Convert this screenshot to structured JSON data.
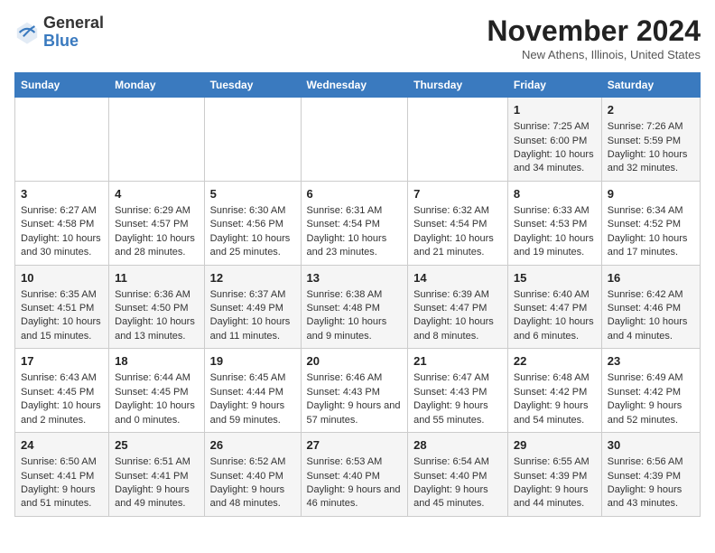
{
  "header": {
    "logo_general": "General",
    "logo_blue": "Blue",
    "month_title": "November 2024",
    "location": "New Athens, Illinois, United States"
  },
  "days_of_week": [
    "Sunday",
    "Monday",
    "Tuesday",
    "Wednesday",
    "Thursday",
    "Friday",
    "Saturday"
  ],
  "weeks": [
    [
      {
        "day": "",
        "info": ""
      },
      {
        "day": "",
        "info": ""
      },
      {
        "day": "",
        "info": ""
      },
      {
        "day": "",
        "info": ""
      },
      {
        "day": "",
        "info": ""
      },
      {
        "day": "1",
        "info": "Sunrise: 7:25 AM\nSunset: 6:00 PM\nDaylight: 10 hours and 34 minutes."
      },
      {
        "day": "2",
        "info": "Sunrise: 7:26 AM\nSunset: 5:59 PM\nDaylight: 10 hours and 32 minutes."
      }
    ],
    [
      {
        "day": "3",
        "info": "Sunrise: 6:27 AM\nSunset: 4:58 PM\nDaylight: 10 hours and 30 minutes."
      },
      {
        "day": "4",
        "info": "Sunrise: 6:29 AM\nSunset: 4:57 PM\nDaylight: 10 hours and 28 minutes."
      },
      {
        "day": "5",
        "info": "Sunrise: 6:30 AM\nSunset: 4:56 PM\nDaylight: 10 hours and 25 minutes."
      },
      {
        "day": "6",
        "info": "Sunrise: 6:31 AM\nSunset: 4:54 PM\nDaylight: 10 hours and 23 minutes."
      },
      {
        "day": "7",
        "info": "Sunrise: 6:32 AM\nSunset: 4:54 PM\nDaylight: 10 hours and 21 minutes."
      },
      {
        "day": "8",
        "info": "Sunrise: 6:33 AM\nSunset: 4:53 PM\nDaylight: 10 hours and 19 minutes."
      },
      {
        "day": "9",
        "info": "Sunrise: 6:34 AM\nSunset: 4:52 PM\nDaylight: 10 hours and 17 minutes."
      }
    ],
    [
      {
        "day": "10",
        "info": "Sunrise: 6:35 AM\nSunset: 4:51 PM\nDaylight: 10 hours and 15 minutes."
      },
      {
        "day": "11",
        "info": "Sunrise: 6:36 AM\nSunset: 4:50 PM\nDaylight: 10 hours and 13 minutes."
      },
      {
        "day": "12",
        "info": "Sunrise: 6:37 AM\nSunset: 4:49 PM\nDaylight: 10 hours and 11 minutes."
      },
      {
        "day": "13",
        "info": "Sunrise: 6:38 AM\nSunset: 4:48 PM\nDaylight: 10 hours and 9 minutes."
      },
      {
        "day": "14",
        "info": "Sunrise: 6:39 AM\nSunset: 4:47 PM\nDaylight: 10 hours and 8 minutes."
      },
      {
        "day": "15",
        "info": "Sunrise: 6:40 AM\nSunset: 4:47 PM\nDaylight: 10 hours and 6 minutes."
      },
      {
        "day": "16",
        "info": "Sunrise: 6:42 AM\nSunset: 4:46 PM\nDaylight: 10 hours and 4 minutes."
      }
    ],
    [
      {
        "day": "17",
        "info": "Sunrise: 6:43 AM\nSunset: 4:45 PM\nDaylight: 10 hours and 2 minutes."
      },
      {
        "day": "18",
        "info": "Sunrise: 6:44 AM\nSunset: 4:45 PM\nDaylight: 10 hours and 0 minutes."
      },
      {
        "day": "19",
        "info": "Sunrise: 6:45 AM\nSunset: 4:44 PM\nDaylight: 9 hours and 59 minutes."
      },
      {
        "day": "20",
        "info": "Sunrise: 6:46 AM\nSunset: 4:43 PM\nDaylight: 9 hours and 57 minutes."
      },
      {
        "day": "21",
        "info": "Sunrise: 6:47 AM\nSunset: 4:43 PM\nDaylight: 9 hours and 55 minutes."
      },
      {
        "day": "22",
        "info": "Sunrise: 6:48 AM\nSunset: 4:42 PM\nDaylight: 9 hours and 54 minutes."
      },
      {
        "day": "23",
        "info": "Sunrise: 6:49 AM\nSunset: 4:42 PM\nDaylight: 9 hours and 52 minutes."
      }
    ],
    [
      {
        "day": "24",
        "info": "Sunrise: 6:50 AM\nSunset: 4:41 PM\nDaylight: 9 hours and 51 minutes."
      },
      {
        "day": "25",
        "info": "Sunrise: 6:51 AM\nSunset: 4:41 PM\nDaylight: 9 hours and 49 minutes."
      },
      {
        "day": "26",
        "info": "Sunrise: 6:52 AM\nSunset: 4:40 PM\nDaylight: 9 hours and 48 minutes."
      },
      {
        "day": "27",
        "info": "Sunrise: 6:53 AM\nSunset: 4:40 PM\nDaylight: 9 hours and 46 minutes."
      },
      {
        "day": "28",
        "info": "Sunrise: 6:54 AM\nSunset: 4:40 PM\nDaylight: 9 hours and 45 minutes."
      },
      {
        "day": "29",
        "info": "Sunrise: 6:55 AM\nSunset: 4:39 PM\nDaylight: 9 hours and 44 minutes."
      },
      {
        "day": "30",
        "info": "Sunrise: 6:56 AM\nSunset: 4:39 PM\nDaylight: 9 hours and 43 minutes."
      }
    ]
  ]
}
